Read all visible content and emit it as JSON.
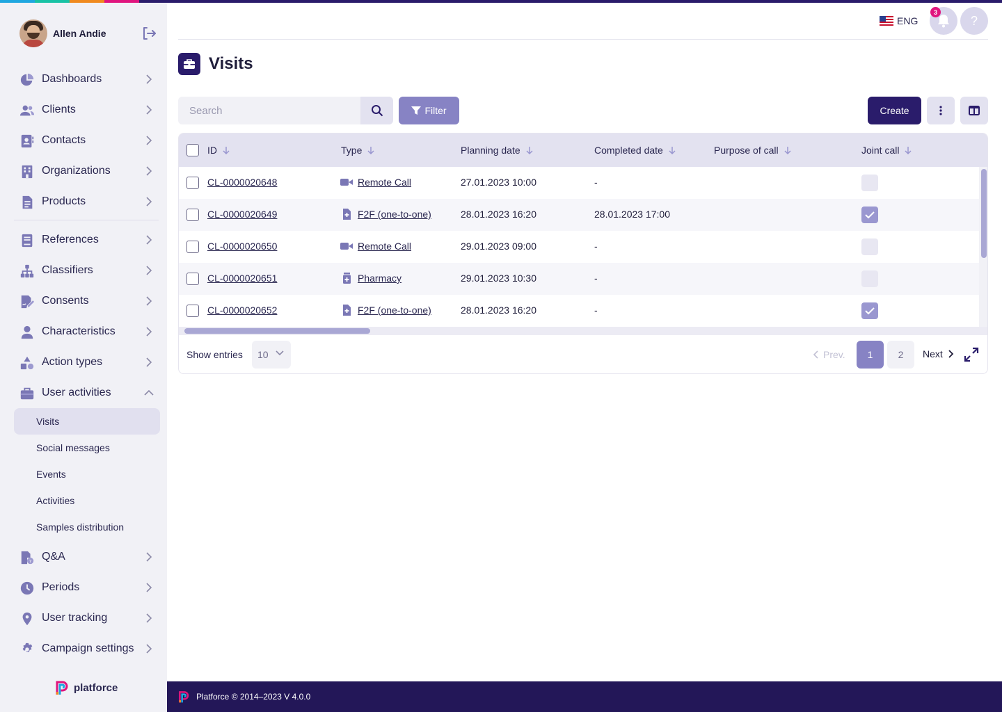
{
  "user": {
    "name": "Allen Andie"
  },
  "sidebar": {
    "items": [
      {
        "label": "Dashboards",
        "icon": "pie-chart-icon"
      },
      {
        "label": "Clients",
        "icon": "users-icon"
      },
      {
        "label": "Contacts",
        "icon": "contact-book-icon"
      },
      {
        "label": "Organizations",
        "icon": "building-icon"
      },
      {
        "label": "Products",
        "icon": "document-icon"
      },
      {
        "label": "References",
        "icon": "book-icon"
      },
      {
        "label": "Classifiers",
        "icon": "sitemap-icon"
      },
      {
        "label": "Consents",
        "icon": "signature-icon"
      },
      {
        "label": "Characteristics",
        "icon": "person-icon"
      },
      {
        "label": "Action types",
        "icon": "shapes-icon"
      },
      {
        "label": "User activities",
        "icon": "briefcase-icon"
      },
      {
        "label": "Q&A",
        "icon": "qa-file-icon"
      },
      {
        "label": "Periods",
        "icon": "clock-icon"
      },
      {
        "label": "User tracking",
        "icon": "location-pin-icon"
      },
      {
        "label": "Campaign settings",
        "icon": "gear-icon"
      }
    ],
    "sub_items": [
      "Visits",
      "Social messages",
      "Events",
      "Activities",
      "Samples distribution"
    ],
    "active_sub": "Visits"
  },
  "brand": {
    "name": "platforce"
  },
  "header": {
    "lang": "ENG",
    "notifications_count": "3",
    "help_label": "?"
  },
  "page": {
    "title": "Visits"
  },
  "toolbar": {
    "search_placeholder": "Search",
    "filter_label": "Filter",
    "create_label": "Create"
  },
  "table": {
    "columns": [
      "ID",
      "Type",
      "Planning date",
      "Completed date",
      "Purpose of call",
      "Joint call"
    ],
    "rows": [
      {
        "id": "CL-0000020648",
        "type": "Remote Call",
        "type_icon": "video-camera-icon",
        "planning": "27.01.2023 10:00",
        "completed": "-",
        "purpose": "",
        "joint": false
      },
      {
        "id": "CL-0000020649",
        "type": "F2F (one-to-one)",
        "type_icon": "medical-file-icon",
        "planning": "28.01.2023 16:20",
        "completed": "28.01.2023 17:00",
        "purpose": "",
        "joint": true
      },
      {
        "id": "CL-0000020650",
        "type": "Remote Call",
        "type_icon": "video-camera-icon",
        "planning": "29.01.2023 09:00",
        "completed": "-",
        "purpose": "",
        "joint": false
      },
      {
        "id": "CL-0000020651",
        "type": "Pharmacy",
        "type_icon": "pharmacy-icon",
        "planning": "29.01.2023 10:30",
        "completed": "-",
        "purpose": "",
        "joint": false
      },
      {
        "id": "CL-0000020652",
        "type": "F2F (one-to-one)",
        "type_icon": "medical-file-icon",
        "planning": "28.01.2023 16:20",
        "completed": "-",
        "purpose": "",
        "joint": true
      }
    ]
  },
  "pagination": {
    "show_entries_label": "Show entries",
    "entries_value": "10",
    "prev_label": "Prev.",
    "pages": [
      "1",
      "2"
    ],
    "current_page": "1",
    "next_label": "Next"
  },
  "footer": {
    "text": "Platforce © 2014–2023 V 4.0.0"
  },
  "colors": {
    "primary_dark": "#2a1c6b",
    "accent": "#8783c4",
    "sidebar_bg": "#f1f1f6",
    "header_row": "#e3e2f0",
    "notification_badge": "#e0157e"
  }
}
